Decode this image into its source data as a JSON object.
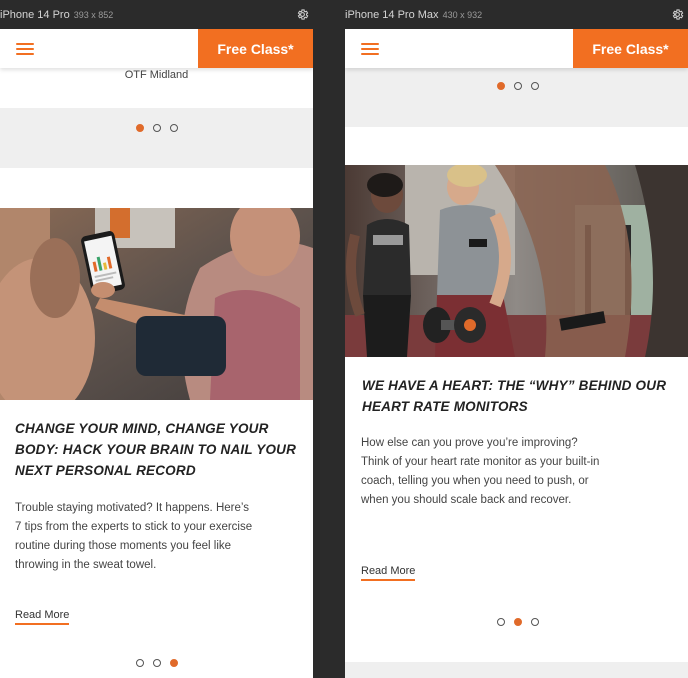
{
  "devices": [
    {
      "name": "iPhone 14 Pro",
      "dims": "393 x 852",
      "nav": {
        "cta_label": "Free Class*"
      },
      "location_label": "OTF Midland",
      "carousel_top": {
        "dots": 3,
        "active": 0
      },
      "article": {
        "title": "CHANGE YOUR MIND, CHANGE YOUR BODY: HACK YOUR BRAIN TO NAIL YOUR NEXT PERSONAL RECORD",
        "body": "Trouble staying motivated? It happens. Here’s 7 tips from the experts to stick to your exercise routine during those moments you feel like throwing in the sweat towel.",
        "read_more": "Read More"
      },
      "carousel_bottom": {
        "dots": 3,
        "active": 2
      }
    },
    {
      "name": "iPhone 14 Pro Max",
      "dims": "430 x 932",
      "nav": {
        "cta_label": "Free Class*"
      },
      "carousel_top": {
        "dots": 3,
        "active": 0
      },
      "article": {
        "title": "WE HAVE A HEART: THE “WHY” BEHIND OUR HEART RATE MONITORS",
        "body": "How else can you prove you’re improving? Think of your heart rate monitor as your built-in coach, telling you when you need to push, or when you should scale back and recover.",
        "read_more": "Read More"
      },
      "carousel_bottom": {
        "dots": 3,
        "active": 1
      }
    }
  ],
  "colors": {
    "accent": "#f26f21",
    "band": "#efefef",
    "frame": "#2b2b2b"
  }
}
